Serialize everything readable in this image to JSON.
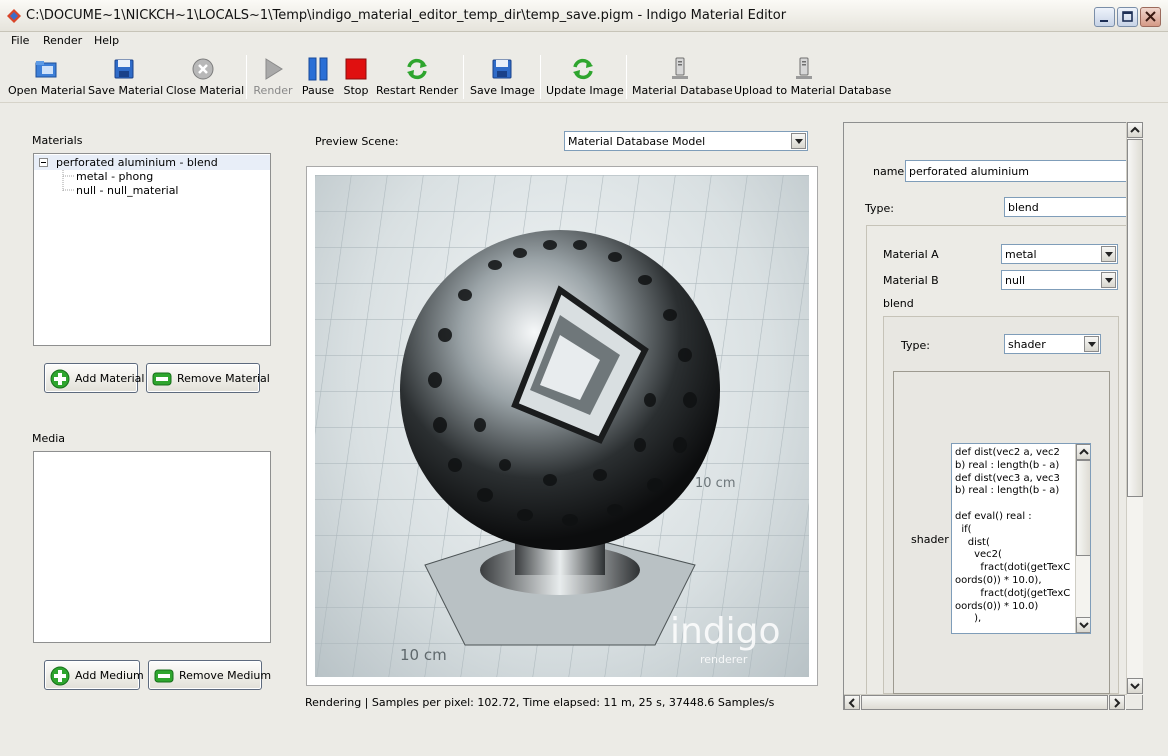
{
  "window": {
    "title": "C:\\DOCUME~1\\NICKCH~1\\LOCALS~1\\Temp\\indigo_material_editor_temp_dir\\temp_save.pigm - Indigo Material Editor"
  },
  "menu": [
    "File",
    "Render",
    "Help"
  ],
  "toolbar": {
    "open_material": "Open Material",
    "save_material": "Save Material",
    "close_material": "Close Material",
    "render": "Render",
    "pause": "Pause",
    "stop": "Stop",
    "restart_render": "Restart Render",
    "save_image": "Save Image",
    "update_image": "Update Image",
    "material_database": "Material Database",
    "upload_database": "Upload to Material Database"
  },
  "materials": {
    "label": "Materials",
    "tree": [
      "perforated aluminium - blend",
      "metal - phong",
      "null - null_material"
    ],
    "add_button": "Add Material",
    "remove_button": "Remove Material"
  },
  "media": {
    "label": "Media",
    "add_button": "Add Medium",
    "remove_button": "Remove Medium"
  },
  "preview": {
    "label": "Preview Scene:",
    "scene": "Material Database Model",
    "watermark": "indigo",
    "watermark_sub": "renderer",
    "ruler_labels": [
      "10 cm",
      "10 cm"
    ],
    "status": "Rendering | Samples per pixel: 102.72, Time elapsed: 11 m, 25 s, 37448.6 Samples/s"
  },
  "properties": {
    "name_label": "name",
    "name_value": "perforated aluminium",
    "type_label": "Type:",
    "type_value": "blend",
    "material_a_label": "Material A",
    "material_a_value": "metal",
    "material_b_label": "Material B",
    "material_b_value": "null",
    "blend_label": "blend",
    "blend_type_label": "Type:",
    "blend_type_value": "shader",
    "shader_label": "shader",
    "shader_code": "def dist(vec2 a, vec2\nb) real : length(b - a)\ndef dist(vec3 a, vec3\nb) real : length(b - a)\n\ndef eval() real :\n  if(\n    dist(\n      vec2(\n        fract(doti(getTexC\noords(0)) * 10.0),\n        fract(dotj(getTexC\noords(0)) * 10.0)\n      ),"
  },
  "colors": {
    "window_bg": "#ecebe6",
    "stop_red": "#e01010",
    "pause_blue": "#2a6fd6",
    "green_icon": "#2ea52e"
  }
}
